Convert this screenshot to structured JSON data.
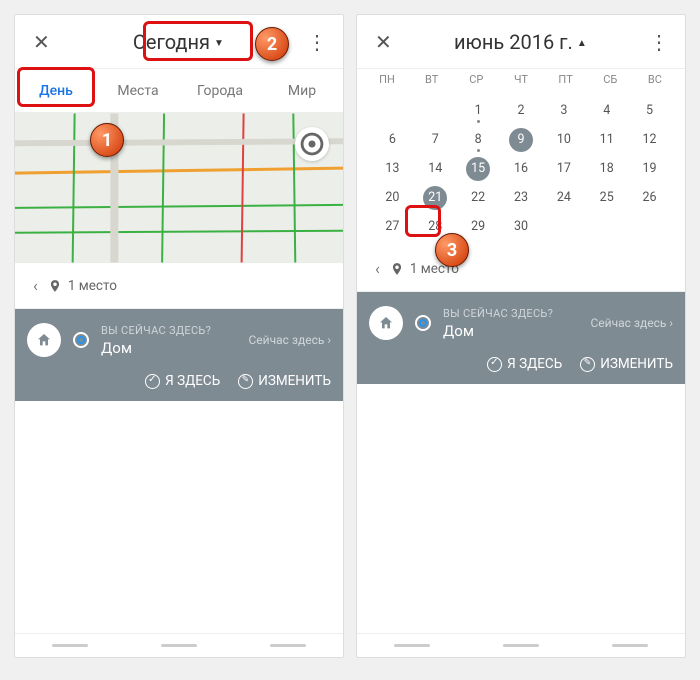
{
  "left": {
    "title": "Сегодня",
    "tabs": [
      "День",
      "Места",
      "Города",
      "Мир"
    ],
    "summary": "1 место",
    "card": {
      "question": "ВЫ СЕЙЧАС ЗДЕСЬ?",
      "location": "Дом",
      "nowHere": "Сейчас здесь",
      "actionHere": "Я ЗДЕСЬ",
      "actionEdit": "ИЗМЕНИТЬ"
    }
  },
  "right": {
    "title": "июнь 2016 г.",
    "weekdays": [
      "ПН",
      "ВТ",
      "СР",
      "ЧТ",
      "ПТ",
      "СБ",
      "ВС"
    ],
    "days": [
      {
        "n": "",
        "dot": false
      },
      {
        "n": "",
        "dot": false
      },
      {
        "n": "1",
        "dot": true
      },
      {
        "n": "2",
        "dot": false
      },
      {
        "n": "3",
        "dot": false
      },
      {
        "n": "4",
        "dot": false
      },
      {
        "n": "5",
        "dot": false
      },
      {
        "n": "6",
        "dot": false
      },
      {
        "n": "7",
        "dot": false
      },
      {
        "n": "8",
        "dot": true
      },
      {
        "n": "9",
        "dot": false,
        "sel": true
      },
      {
        "n": "10",
        "dot": false
      },
      {
        "n": "11",
        "dot": false
      },
      {
        "n": "12",
        "dot": false
      },
      {
        "n": "13",
        "dot": false
      },
      {
        "n": "14",
        "dot": false
      },
      {
        "n": "15",
        "dot": false,
        "sel": true
      },
      {
        "n": "16",
        "dot": false
      },
      {
        "n": "17",
        "dot": false
      },
      {
        "n": "18",
        "dot": false
      },
      {
        "n": "19",
        "dot": false
      },
      {
        "n": "20",
        "dot": false
      },
      {
        "n": "21",
        "dot": false,
        "sel": true
      },
      {
        "n": "22",
        "dot": false
      },
      {
        "n": "23",
        "dot": false
      },
      {
        "n": "24",
        "dot": false
      },
      {
        "n": "25",
        "dot": false
      },
      {
        "n": "26",
        "dot": false
      },
      {
        "n": "27",
        "dot": false
      },
      {
        "n": "28",
        "dot": false
      },
      {
        "n": "29",
        "dot": false
      },
      {
        "n": "30",
        "dot": false
      },
      {
        "n": "",
        "dot": false
      },
      {
        "n": "",
        "dot": false
      },
      {
        "n": "",
        "dot": false
      }
    ],
    "summary": "1 место",
    "card": {
      "question": "ВЫ СЕЙЧАС ЗДЕСЬ?",
      "location": "Дом",
      "nowHere": "Сейчас здесь",
      "actionHere": "Я ЗДЕСЬ",
      "actionEdit": "ИЗМЕНИТЬ"
    }
  },
  "badges": {
    "b1": "1",
    "b2": "2",
    "b3": "3"
  }
}
